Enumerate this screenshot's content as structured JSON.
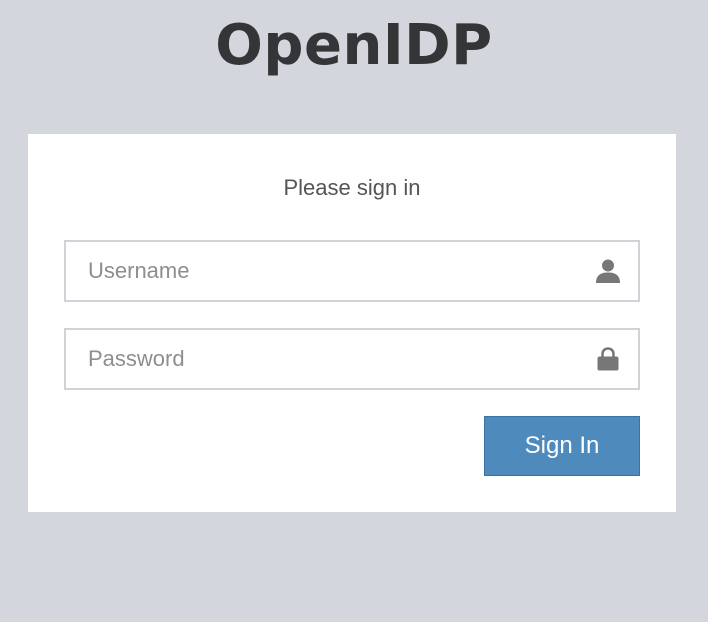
{
  "app": {
    "title": "OpenIDP"
  },
  "login": {
    "heading": "Please sign in",
    "username": {
      "placeholder": "Username",
      "value": "",
      "icon": "user-icon"
    },
    "password": {
      "placeholder": "Password",
      "value": "",
      "icon": "lock-icon"
    },
    "submit_label": "Sign In"
  },
  "colors": {
    "background": "#d3d6dd",
    "card": "#ffffff",
    "button": "#4e8abc",
    "input_border": "#cfd2d6",
    "icon": "#777777"
  }
}
